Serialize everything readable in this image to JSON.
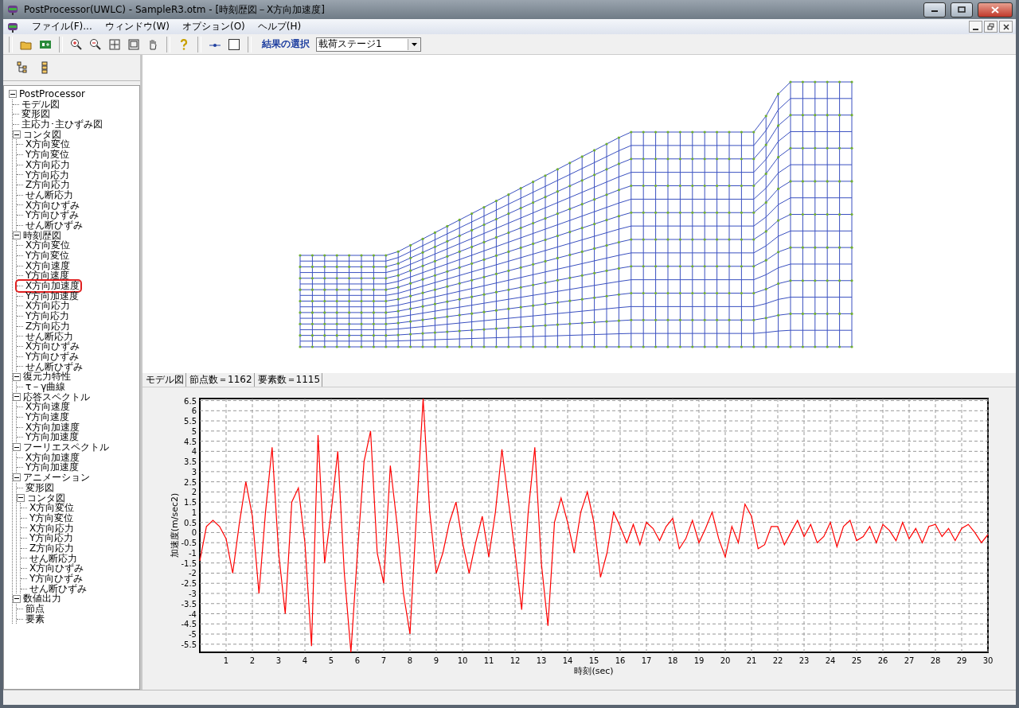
{
  "window": {
    "title": "PostProcessor(UWLC) - SampleR3.otm - [時刻歴図－X方向加速度]"
  },
  "menu": [
    "ファイル(F)...",
    "ウィンドウ(W)",
    "オプション(O)",
    "ヘルプ(H)"
  ],
  "toolbar": {
    "result_label": "結果の選択",
    "result_select": {
      "value": "載荷ステージ1"
    }
  },
  "tree": {
    "items": [
      {
        "label": "PostProcessor",
        "expanded": true,
        "children": [
          {
            "label": "モデル図"
          },
          {
            "label": "変形図"
          },
          {
            "label": "主応力･主ひずみ図"
          },
          {
            "label": "コンタ図",
            "expanded": true,
            "children": [
              {
                "label": "X方向変位"
              },
              {
                "label": "Y方向変位"
              },
              {
                "label": "X方向応力"
              },
              {
                "label": "Y方向応力"
              },
              {
                "label": "Z方向応力"
              },
              {
                "label": "せん断応力"
              },
              {
                "label": "X方向ひずみ"
              },
              {
                "label": "Y方向ひずみ"
              },
              {
                "label": "せん断ひずみ"
              }
            ]
          },
          {
            "label": "時刻歴図",
            "expanded": true,
            "children": [
              {
                "label": "X方向変位",
                "circled": false
              },
              {
                "label": "Y方向変位",
                "circled": false
              },
              {
                "label": "X方向速度",
                "circled": false
              },
              {
                "label": "Y方向速度",
                "circled": false
              },
              {
                "label": "X方向加速度",
                "circled": true
              },
              {
                "label": "Y方向加速度",
                "circled": false
              },
              {
                "label": "X方向応力",
                "circled": false
              },
              {
                "label": "Y方向応力",
                "circled": false
              },
              {
                "label": "Z方向応力",
                "circled": false
              },
              {
                "label": "せん断応力",
                "circled": false
              },
              {
                "label": "X方向ひずみ",
                "circled": false
              },
              {
                "label": "Y方向ひずみ",
                "circled": false
              },
              {
                "label": "せん断ひずみ",
                "circled": false
              }
            ]
          },
          {
            "label": "復元力特性",
            "expanded": true,
            "children": [
              {
                "label": "τ－γ曲線"
              }
            ]
          },
          {
            "label": "応答スペクトル",
            "expanded": true,
            "children": [
              {
                "label": "X方向速度"
              },
              {
                "label": "Y方向速度"
              },
              {
                "label": "X方向加速度"
              },
              {
                "label": "Y方向加速度"
              }
            ]
          },
          {
            "label": "フーリエスペクトル",
            "expanded": true,
            "children": [
              {
                "label": "X方向加速度"
              },
              {
                "label": "Y方向加速度"
              }
            ]
          },
          {
            "label": "アニメーション",
            "expanded": true,
            "children": [
              {
                "label": "変形図"
              },
              {
                "label": "コンタ図",
                "expanded": true,
                "children": [
                  {
                    "label": "X方向変位"
                  },
                  {
                    "label": "Y方向変位"
                  },
                  {
                    "label": "X方向応力"
                  },
                  {
                    "label": "Y方向応力"
                  },
                  {
                    "label": "Z方向応力"
                  },
                  {
                    "label": "せん断応力"
                  },
                  {
                    "label": "X方向ひずみ"
                  },
                  {
                    "label": "Y方向ひずみ"
                  },
                  {
                    "label": "せん断ひずみ"
                  }
                ]
              }
            ]
          },
          {
            "label": "数値出力",
            "expanded": true,
            "children": [
              {
                "label": "節点"
              },
              {
                "label": "要素"
              }
            ]
          }
        ]
      }
    ]
  },
  "model_status": [
    "モデル図",
    "節点数＝1162",
    "要素数＝1115"
  ],
  "chart": {
    "chart_data": {
      "type": "line",
      "grid": true,
      "xlabel": "時刻(sec)",
      "ylabel": "加速度(m/sec2)",
      "xlim": [
        0,
        30
      ],
      "ylim": [
        -5.9,
        6.6
      ],
      "xticks": [
        1,
        2,
        3,
        4,
        5,
        6,
        7,
        8,
        9,
        10,
        11,
        12,
        13,
        14,
        15,
        16,
        17,
        18,
        19,
        20,
        21,
        22,
        23,
        24,
        25,
        26,
        27,
        28,
        29,
        30
      ],
      "yticks": [
        -5.5,
        -5,
        -4.5,
        -4,
        -3.5,
        -3,
        -2.5,
        -2,
        -1.5,
        -1,
        -0.5,
        0,
        0.5,
        1,
        1.5,
        2,
        2.5,
        3,
        3.5,
        4,
        4.5,
        5,
        5.5,
        6,
        6.5
      ],
      "x": [
        0,
        0.25,
        0.5,
        0.75,
        1,
        1.25,
        1.5,
        1.75,
        2,
        2.25,
        2.5,
        2.75,
        3,
        3.25,
        3.5,
        3.75,
        4,
        4.25,
        4.5,
        4.75,
        5,
        5.25,
        5.5,
        5.75,
        6,
        6.25,
        6.5,
        6.75,
        7,
        7.25,
        7.5,
        7.75,
        8,
        8.25,
        8.5,
        8.75,
        9,
        9.25,
        9.5,
        9.75,
        10,
        10.25,
        10.5,
        10.75,
        11,
        11.25,
        11.5,
        11.75,
        12,
        12.25,
        12.5,
        12.75,
        13,
        13.25,
        13.5,
        13.75,
        14,
        14.25,
        14.5,
        14.75,
        15,
        15.25,
        15.5,
        15.75,
        16,
        16.25,
        16.5,
        16.75,
        17,
        17.25,
        17.5,
        17.75,
        18,
        18.25,
        18.5,
        18.75,
        19,
        19.25,
        19.5,
        19.75,
        20,
        20.25,
        20.5,
        20.75,
        21,
        21.25,
        21.5,
        21.75,
        22,
        22.25,
        22.5,
        22.75,
        23,
        23.25,
        23.5,
        23.75,
        24,
        24.25,
        24.5,
        24.75,
        25,
        25.25,
        25.5,
        25.75,
        26,
        26.25,
        26.5,
        26.75,
        27,
        27.25,
        27.5,
        27.75,
        28,
        28.25,
        28.5,
        28.75,
        29,
        29.25,
        29.5,
        29.75,
        30
      ],
      "series": [
        {
          "color": "#ff0000",
          "values": [
            -1.4,
            0.3,
            0.6,
            0.3,
            -0.3,
            -2.0,
            0.4,
            2.5,
            0.8,
            -3.0,
            1.0,
            4.2,
            -1.0,
            -4.0,
            1.5,
            2.2,
            -0.5,
            -5.6,
            4.8,
            -1.5,
            1.0,
            4.0,
            -2.0,
            -5.9,
            -1.0,
            3.5,
            5.0,
            -1.0,
            -2.5,
            3.3,
            0.5,
            -3.0,
            -5.0,
            1.0,
            6.6,
            1.0,
            -2.0,
            -1.0,
            0.5,
            1.5,
            -0.5,
            -2.0,
            -0.5,
            0.8,
            -1.2,
            1.0,
            4.1,
            1.5,
            -1.0,
            -3.8,
            1.0,
            4.2,
            -1.5,
            -4.6,
            0.5,
            1.7,
            0.5,
            -1.0,
            1.0,
            2.0,
            0.5,
            -2.2,
            -1.0,
            1.0,
            0.3,
            -0.5,
            0.4,
            -0.6,
            0.5,
            0.2,
            -0.4,
            0.3,
            0.7,
            -0.8,
            -0.3,
            0.6,
            -0.5,
            0.2,
            1.0,
            -0.3,
            -1.2,
            0.3,
            -0.5,
            1.4,
            0.8,
            -0.8,
            -0.6,
            0.3,
            0.3,
            -0.6,
            0.0,
            0.6,
            -0.2,
            0.4,
            -0.5,
            -0.2,
            0.5,
            -0.7,
            0.3,
            0.6,
            -0.4,
            -0.2,
            0.3,
            -0.5,
            0.4,
            0.1,
            -0.4,
            0.5,
            -0.3,
            0.2,
            -0.5,
            0.3,
            0.4,
            -0.2,
            0.2,
            -0.4,
            0.2,
            0.4,
            0.0,
            -0.5,
            -0.1
          ]
        }
      ]
    }
  }
}
